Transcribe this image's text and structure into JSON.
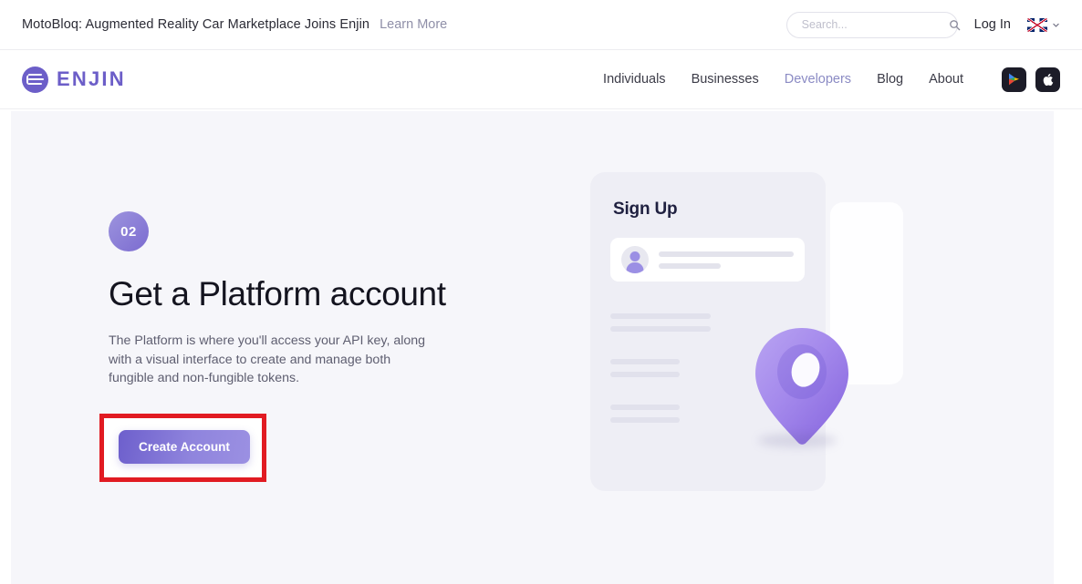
{
  "announcement": {
    "text": "MotoBloq: Augmented Reality Car Marketplace Joins Enjin",
    "link_label": "Learn More"
  },
  "search": {
    "placeholder": "Search...",
    "value": "",
    "icon": "search-icon"
  },
  "account": {
    "login_label": "Log In",
    "language_flag": "uk-flag-icon",
    "language_chevron": "chevron-down-icon"
  },
  "brand": {
    "wordmark": "ENJIN",
    "logo_icon": "enjin-logo-icon",
    "color": "#6c5ec8"
  },
  "nav": {
    "items": [
      {
        "label": "Individuals",
        "active": false
      },
      {
        "label": "Businesses",
        "active": false
      },
      {
        "label": "Developers",
        "active": true
      },
      {
        "label": "Blog",
        "active": false
      },
      {
        "label": "About",
        "active": false
      }
    ],
    "active_color": "#8b8bc4",
    "store_badges": [
      {
        "name": "google-play-badge"
      },
      {
        "name": "apple-app-store-badge"
      }
    ]
  },
  "hero": {
    "step_number": "02",
    "title": "Get a Platform account",
    "body": "The Platform is where you'll access your API key, along with a visual interface to create and manage both fungible and non-fungible tokens.",
    "cta_label": "Create Account",
    "cta_gradient_from": "#6d5fcc",
    "cta_gradient_to": "#9b90e2",
    "highlight_color": "#e11b22"
  },
  "illustration": {
    "card_title": "Sign Up",
    "pin_color": "#9b7ee8",
    "avatar_icon": "user-avatar-icon",
    "background_color": "#f6f6fa"
  }
}
